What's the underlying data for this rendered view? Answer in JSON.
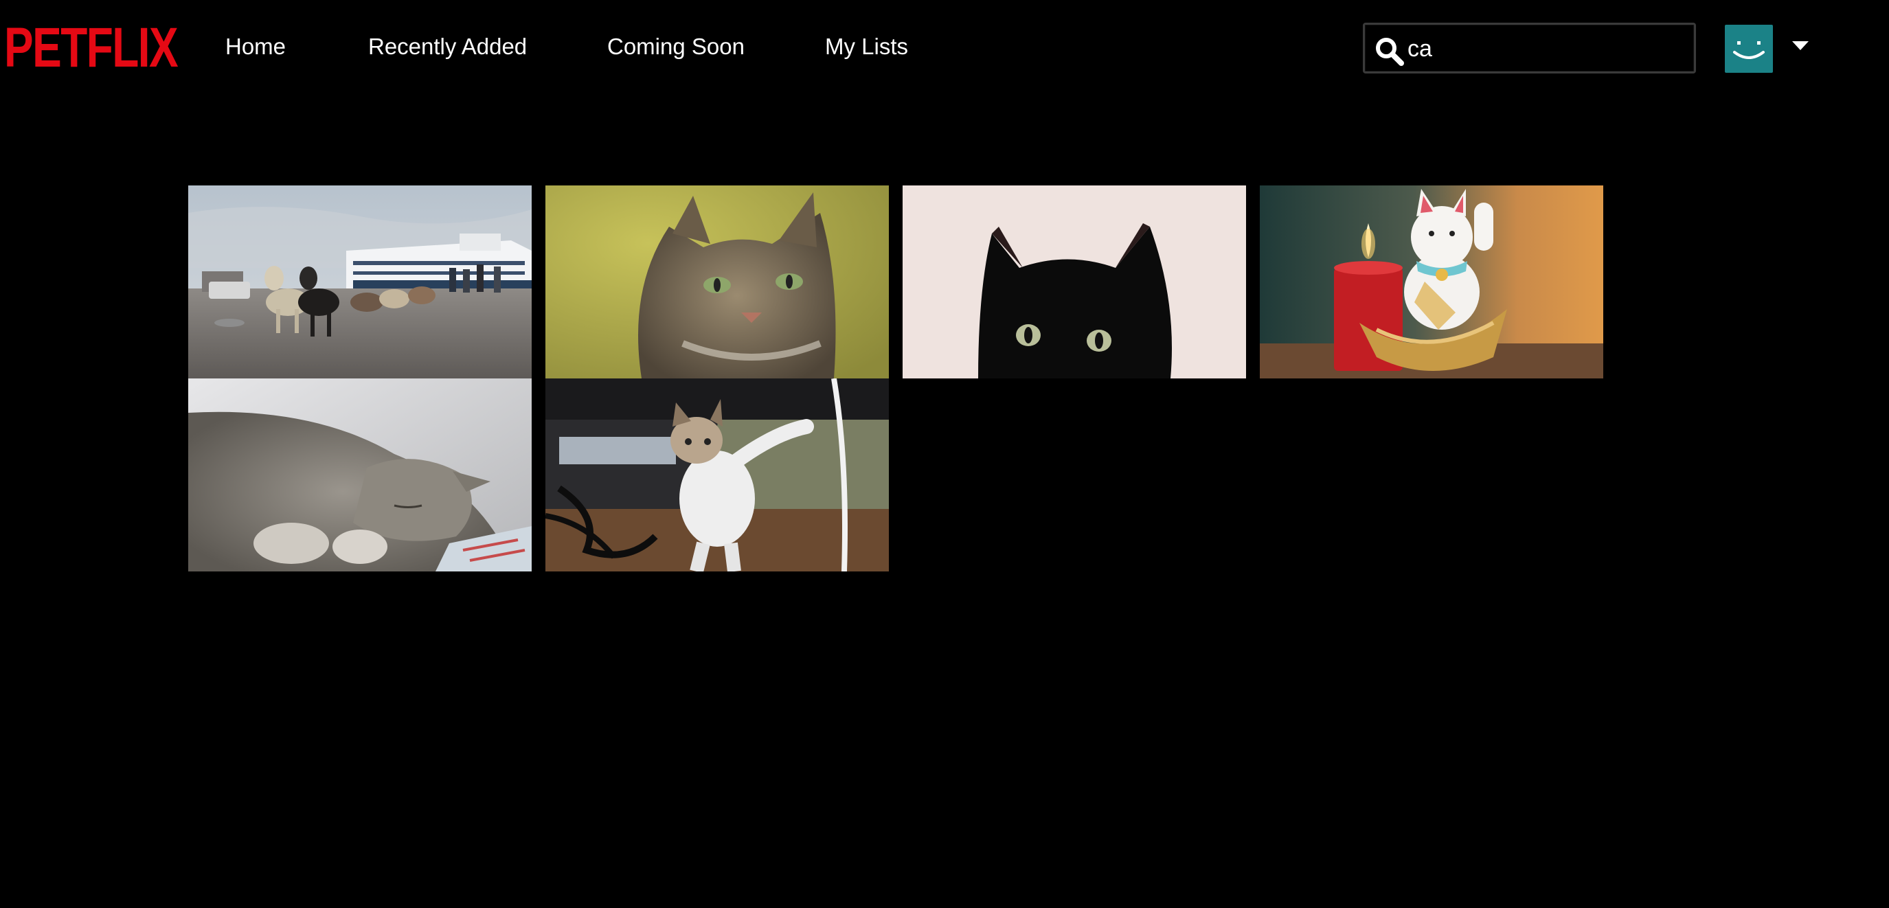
{
  "header": {
    "logo_text": "PETFLIX",
    "nav": [
      {
        "label": "Home"
      },
      {
        "label": "Recently Added"
      },
      {
        "label": "Coming Soon"
      },
      {
        "label": "My Lists"
      }
    ],
    "search": {
      "value": "ca",
      "icon": "search-icon"
    },
    "profile": {
      "avatar_icon": "smiley-face-icon",
      "avatar_color": "#1b8287",
      "menu_icon": "caret-down-icon"
    }
  },
  "colors": {
    "brand": "#e50914",
    "background": "#000000",
    "text": "#ffffff"
  },
  "results": [
    {
      "thumbnail": "sled-dogs-at-harbor-with-cruise-ship"
    },
    {
      "thumbnail": "tabby-cat-portrait-yellow-background"
    },
    {
      "thumbnail": "black-cat-peeking-up"
    },
    {
      "thumbnail": "lucky-cat-figurine-with-red-candle"
    },
    {
      "thumbnail": "sleeping-tabby-cat"
    },
    {
      "thumbnail": "kitten-playing-with-cable"
    }
  ]
}
